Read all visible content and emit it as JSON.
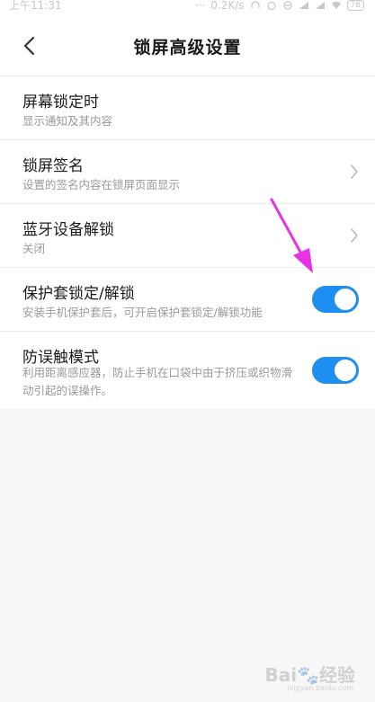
{
  "status_bar": {
    "time": "上午11:31",
    "speed": "0.2K/s",
    "battery": "78"
  },
  "header": {
    "title": "锁屏高级设置"
  },
  "settings": [
    {
      "title": "屏幕锁定时",
      "subtitle": "显示通知及其内容"
    },
    {
      "title": "锁屏签名",
      "subtitle": "设置的签名内容在锁屏页面显示"
    },
    {
      "title": "蓝牙设备解锁",
      "subtitle": "关闭"
    },
    {
      "title": "保护套锁定/解锁",
      "subtitle": "安装手机保护套后，可开启保护套锁定/解锁功能",
      "toggle_on": true
    },
    {
      "title": "防误触模式",
      "subtitle": "利用距离感应器，防止手机在口袋中由于挤压或织物滑动引起的误操作。",
      "toggle_on": true
    }
  ],
  "colors": {
    "toggle_on": "#1e8ef0",
    "annotation_arrow": "#e633e6"
  },
  "watermark": {
    "brand": "Bai",
    "brand_suffix": "经验",
    "site": "jingyan.baidu.com"
  }
}
